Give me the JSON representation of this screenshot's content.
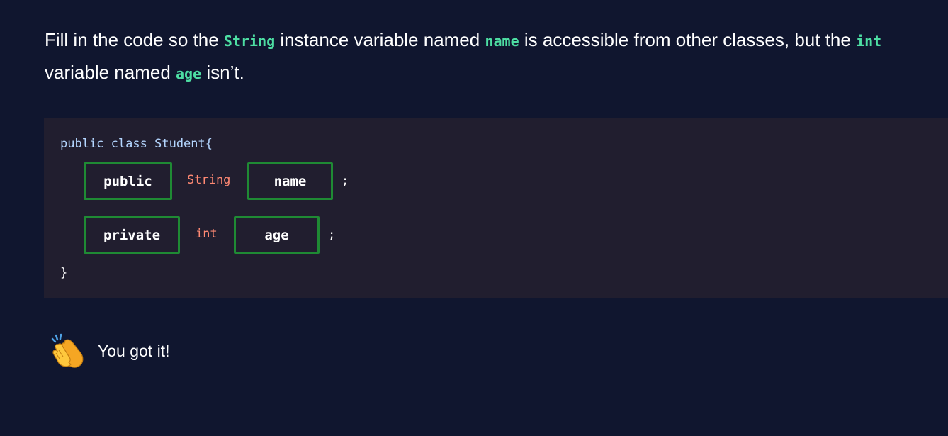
{
  "prompt": {
    "part1": "Fill in the code so the ",
    "kw_string": "String",
    "part2": " instance variable named ",
    "kw_name": "name",
    "part3": " is accessible from other classes, but the ",
    "kw_int": "int",
    "part4": " variable named ",
    "kw_age": "age",
    "part5": " isn’t."
  },
  "code": {
    "kw_public": "public",
    "kw_class": "class",
    "class_name": "Student{",
    "line1": {
      "modifier_slot": "public",
      "type": "String",
      "name_slot": "name",
      "semicolon": ";"
    },
    "line2": {
      "modifier_slot": "private",
      "type": "int",
      "name_slot": "age",
      "semicolon": ";"
    },
    "closing_brace": "}"
  },
  "feedback": {
    "icon": "clapping-hands-icon",
    "message": "You got it!"
  },
  "colors": {
    "background": "#10162f",
    "code_panel": "#211e2f",
    "keyword_highlight": "#4ddea3",
    "type_color": "#ff8973",
    "slot_border": "#1f8a34"
  }
}
